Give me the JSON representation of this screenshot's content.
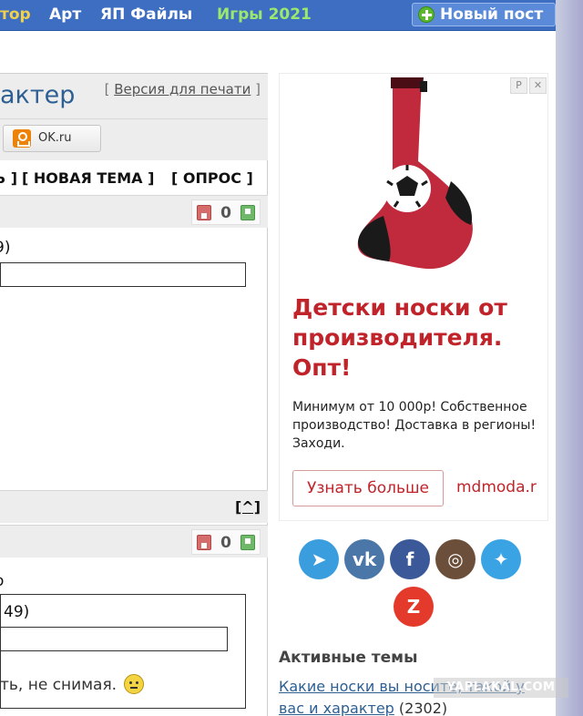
{
  "nav": {
    "items": [
      "тор",
      "Арт",
      "ЯП Файлы",
      "Игры 2021"
    ],
    "new_post_label": "Новый пост"
  },
  "topic": {
    "title_fragment": "актер",
    "print_bracket_open": "[",
    "print_version_label": "Версия для печати",
    "print_bracket_close": "]",
    "share_ok_label": "OK.ru",
    "actions": [
      "Ь ]",
      "[ НОВАЯ ТЕМА ]",
      "[ ОПРОС ]"
    ]
  },
  "posts": [
    {
      "rating": "0",
      "meta_fragment": "9)"
    },
    {
      "rating": "0",
      "meta_fragment": "о",
      "inner_quote_fragment": "49)",
      "text_fragment": "ть, не снимая."
    }
  ],
  "back_to_top_label": "[^]",
  "ad": {
    "badges": [
      "Р",
      "✕"
    ],
    "headline": "Детски носки от производителя. Опт!",
    "body": "Минимум от 10 000р! Собственное производство! Доставка в регионы! Заходи.",
    "cta_label": "Узнать больше",
    "domain": "mdmoda.r"
  },
  "social": [
    {
      "name": "telegram",
      "glyph": "➤",
      "color": "#3a9ede"
    },
    {
      "name": "vk",
      "glyph": "vk",
      "color": "#4a76a8"
    },
    {
      "name": "facebook",
      "glyph": "f",
      "color": "#3b5998"
    },
    {
      "name": "instagram",
      "glyph": "◎",
      "color": "#6b4f3a"
    },
    {
      "name": "twitter",
      "glyph": "✦",
      "color": "#3aa3e3"
    },
    {
      "name": "zen",
      "glyph": "Z",
      "color": "#e33a2c"
    }
  ],
  "active_topics": {
    "title": "Активные темы",
    "items": [
      {
        "link": "Какие носки вы носите, такой у вас и характер",
        "count": "(2302)"
      }
    ]
  },
  "watermark": "YAPLAKAL.COM",
  "colors": {
    "nav_bg": "#3e6ec2",
    "link_blue": "#2d5f93",
    "ad_red": "#c0242a"
  }
}
